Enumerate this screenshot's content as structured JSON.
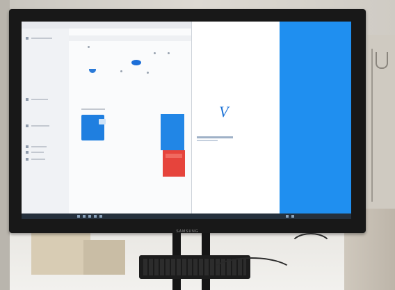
{
  "monitor": {
    "brand": "SAMSUNG"
  },
  "colors": {
    "accent_blue": "#1f8ff0",
    "tile_blue": "#2186e6",
    "tile_red": "#e6443c",
    "taskbar": "#25303c"
  },
  "icons": {
    "logo_mark": "stylized-v-logo-icon",
    "red_tile": "red-app-tile-icon",
    "blue_tile": "blue-app-tile-icon",
    "blue_pill": "blue-pill-icon"
  }
}
